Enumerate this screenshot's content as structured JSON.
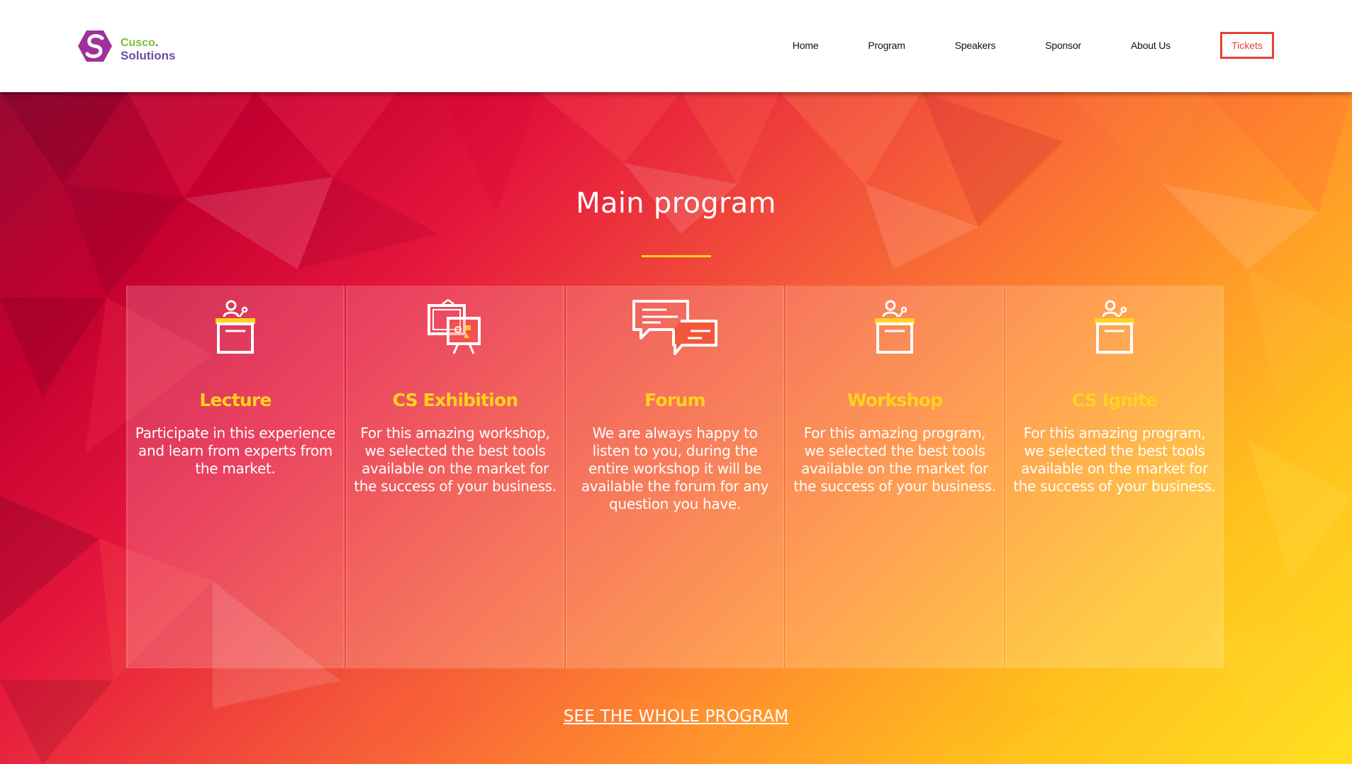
{
  "brand": {
    "line1": "Cusco",
    "line1_dot": ".",
    "line2": "Solutions",
    "colors": {
      "green": "#7bbf3a",
      "purple": "#6b4fa0",
      "magenta": "#a0309a"
    }
  },
  "nav": {
    "items": [
      "Home",
      "Program",
      "Speakers",
      "Sponsor",
      "About Us"
    ],
    "tickets": "Tickets"
  },
  "main": {
    "title": "Main program",
    "cards": [
      {
        "icon": "podium-icon",
        "title": "Lecture",
        "desc": "Participate in this experience and learn from experts from the market."
      },
      {
        "icon": "exhibition-board-icon",
        "title": "CS Exhibition",
        "desc": "For this amazing workshop, we selected the best tools available on the market for the success of your business."
      },
      {
        "icon": "chat-bubbles-icon",
        "title": "Forum",
        "desc": "We are always happy to listen to you, during the entire workshop it will be available the forum for any question you have."
      },
      {
        "icon": "podium-icon",
        "title": "Workshop",
        "desc": "For this amazing program, we selected the best tools available on the market for the success of your business."
      },
      {
        "icon": "podium-icon",
        "title": "CS Ignite",
        "desc": "For this amazing program, we selected the best tools available on the market for the success of your business."
      }
    ],
    "see_all": "SEE THE WHOLE PROGRAM"
  },
  "colors": {
    "accent_yellow": "#ffd21f",
    "tickets_red": "#e8413a"
  }
}
